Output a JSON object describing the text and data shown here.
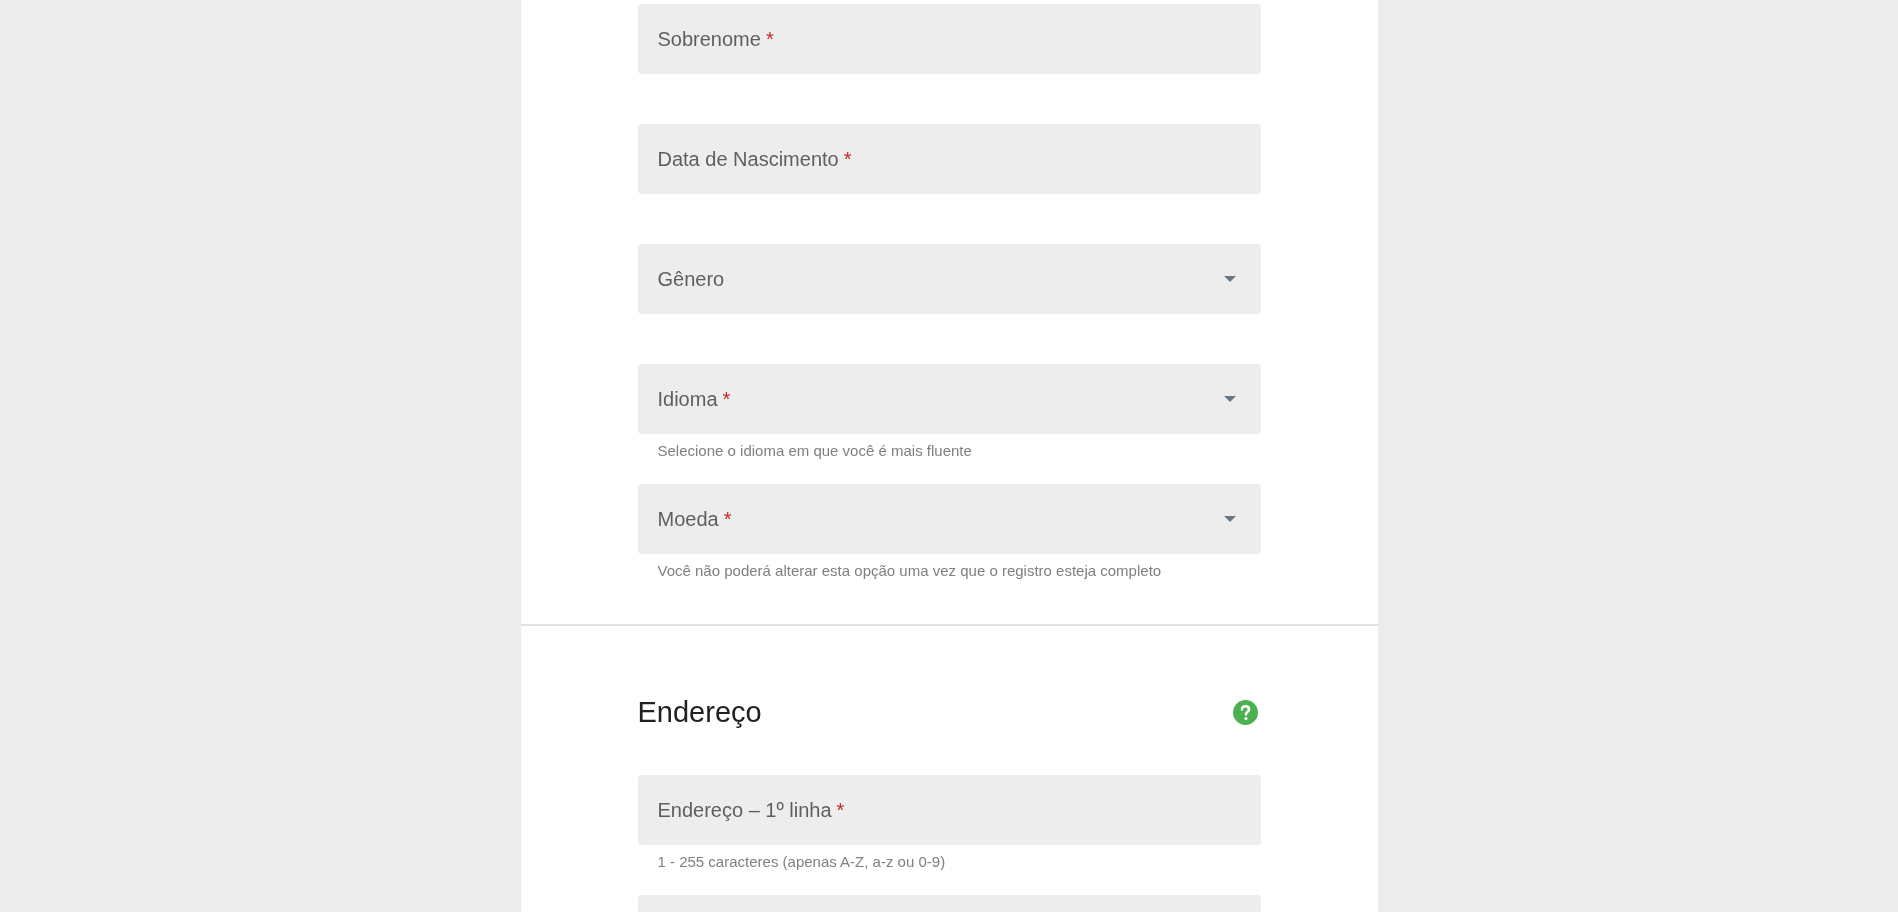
{
  "sections": [
    {
      "fields": [
        {
          "kind": "text",
          "label": "Sobrenome",
          "required_mark": "*"
        },
        {
          "kind": "text",
          "label": "Data de Nascimento",
          "required_mark": "*"
        },
        {
          "kind": "select",
          "label": "Gênero"
        },
        {
          "kind": "select",
          "label": "Idioma",
          "required_mark": "*",
          "helper": "Selecione o idioma em que você é mais fluente"
        },
        {
          "kind": "select",
          "label": "Moeda",
          "required_mark": "*",
          "helper": "Você não poderá alterar esta opção uma vez que o registro esteja completo"
        }
      ]
    },
    {
      "title": "Endereço",
      "help": true,
      "fields": [
        {
          "kind": "text",
          "label": "Endereço – 1º linha",
          "required_mark": "*",
          "helper": "1 - 255 caracteres (apenas A-Z, a-z ou 0-9)"
        },
        {
          "kind": "text"
        }
      ]
    }
  ]
}
